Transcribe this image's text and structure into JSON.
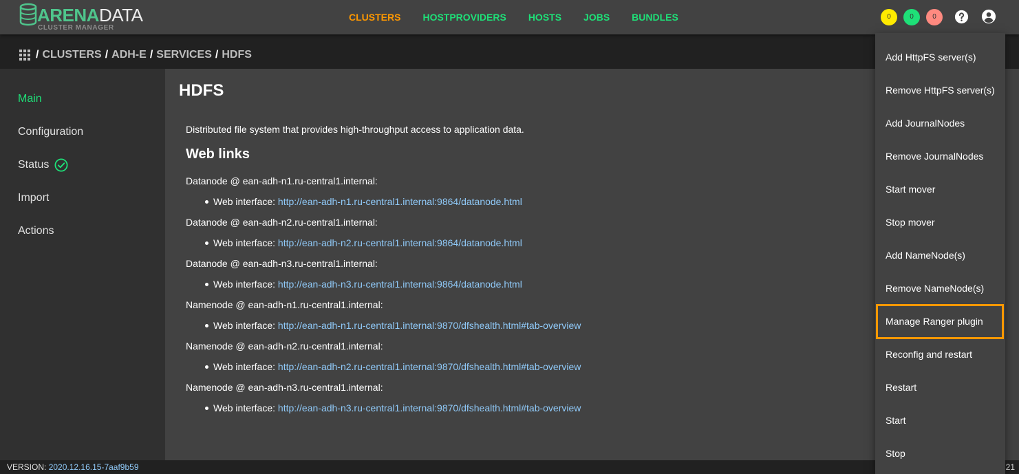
{
  "brand": {
    "name_bold": "ARENA",
    "name_thin": "DATA",
    "subtitle": "CLUSTER MANAGER",
    "accent": "#1ee078",
    "active": "#ff9800"
  },
  "nav": {
    "items": [
      "CLUSTERS",
      "HOSTPROVIDERS",
      "HOSTS",
      "JOBS",
      "BUNDLES"
    ],
    "active": "CLUSTERS"
  },
  "counters": {
    "warnings": "0",
    "success": "0",
    "errors": "0"
  },
  "icons": {
    "help": "help-icon",
    "user": "account-icon",
    "apps": "apps-grid-icon",
    "status_ok": "check-circle-icon"
  },
  "breadcrumb": {
    "items": [
      "CLUSTERS",
      "ADH-E",
      "SERVICES",
      "HDFS"
    ]
  },
  "sidebar": {
    "items": [
      "Main",
      "Configuration",
      "Status",
      "Import",
      "Actions"
    ],
    "active": "Main"
  },
  "main": {
    "title": "HDFS",
    "description": "Distributed file system that provides high-throughput access to application data.",
    "web_links_title": "Web links",
    "link_prefix": "Web interface:",
    "groups": [
      {
        "title": "Datanode @ ean-adh-n1.ru-central1.internal:",
        "url": "http://ean-adh-n1.ru-central1.internal:9864/datanode.html"
      },
      {
        "title": "Datanode @ ean-adh-n2.ru-central1.internal:",
        "url": "http://ean-adh-n2.ru-central1.internal:9864/datanode.html"
      },
      {
        "title": "Datanode @ ean-adh-n3.ru-central1.internal:",
        "url": "http://ean-adh-n3.ru-central1.internal:9864/datanode.html"
      },
      {
        "title": "Namenode @ ean-adh-n1.ru-central1.internal:",
        "url": "http://ean-adh-n1.ru-central1.internal:9870/dfshealth.html#tab-overview"
      },
      {
        "title": "Namenode @ ean-adh-n2.ru-central1.internal:",
        "url": "http://ean-adh-n2.ru-central1.internal:9870/dfshealth.html#tab-overview"
      },
      {
        "title": "Namenode @ ean-adh-n3.ru-central1.internal:",
        "url": "http://ean-adh-n3.ru-central1.internal:9870/dfshealth.html#tab-overview"
      }
    ]
  },
  "actions_menu": {
    "items": [
      "Add HttpFS server(s)",
      "Remove HttpFS server(s)",
      "Add JournalNodes",
      "Remove JournalNodes",
      "Start mover",
      "Stop mover",
      "Add NameNode(s)",
      "Remove NameNode(s)",
      "Manage Ranger plugin",
      "Reconfig and restart",
      "Restart",
      "Start",
      "Stop"
    ],
    "highlighted": "Manage Ranger plugin"
  },
  "footer": {
    "version_label": "VERSION:",
    "version_value": "2020.12.16.15-7aaf9b59",
    "right_fragment": "21"
  }
}
